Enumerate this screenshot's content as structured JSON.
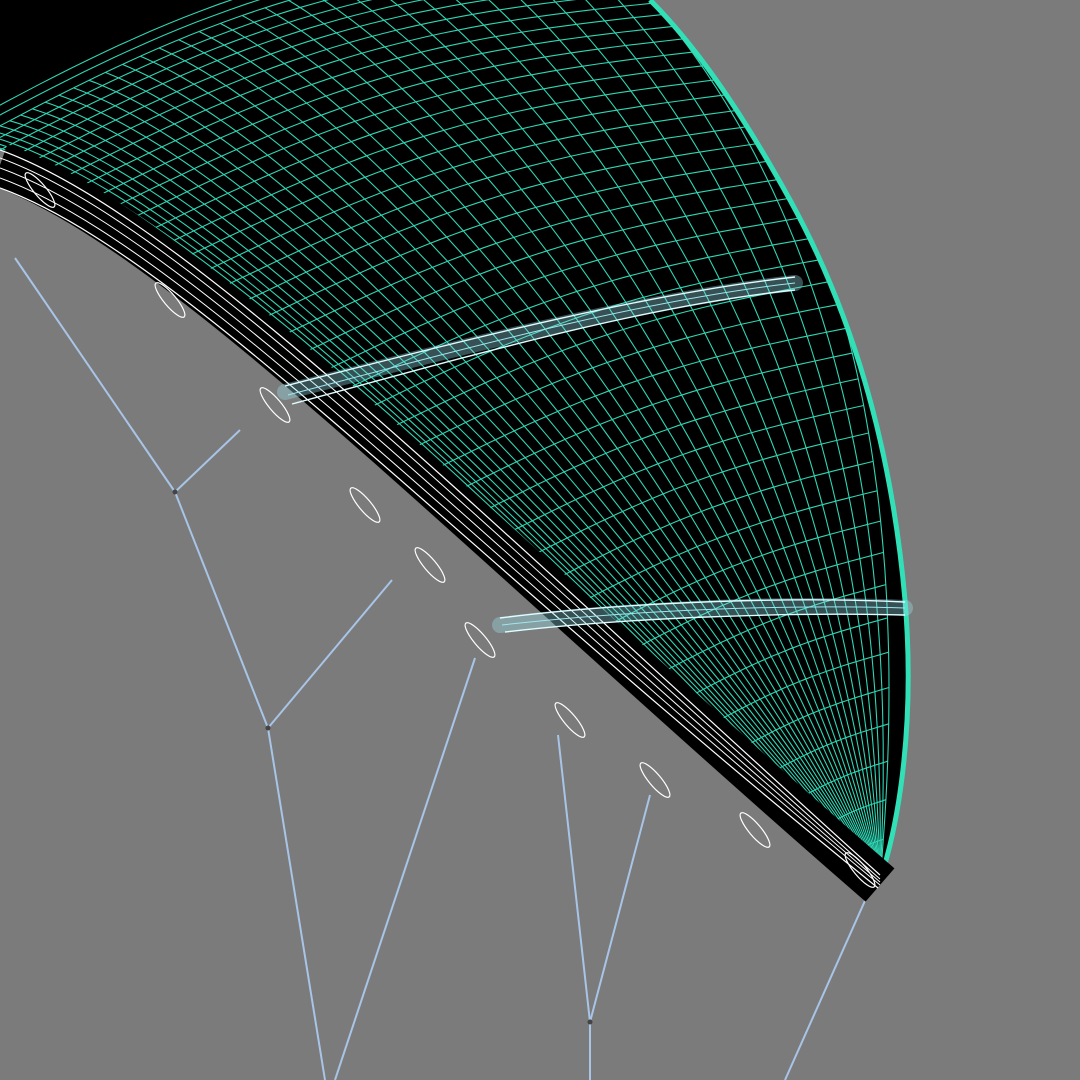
{
  "scene": {
    "subject": "kite-wireframe",
    "colors": {
      "background": "#7b7b7b",
      "canopy_fill": "#000000",
      "mesh": "#2fd6b4",
      "mesh_edge": "#32e0b8",
      "leading_edge": "#ffffff",
      "struts": "#9fe6f0",
      "lines": "#a8c4e6"
    },
    "grid": {
      "spanwise_lines": 34,
      "chordwise_lines": 40
    }
  }
}
